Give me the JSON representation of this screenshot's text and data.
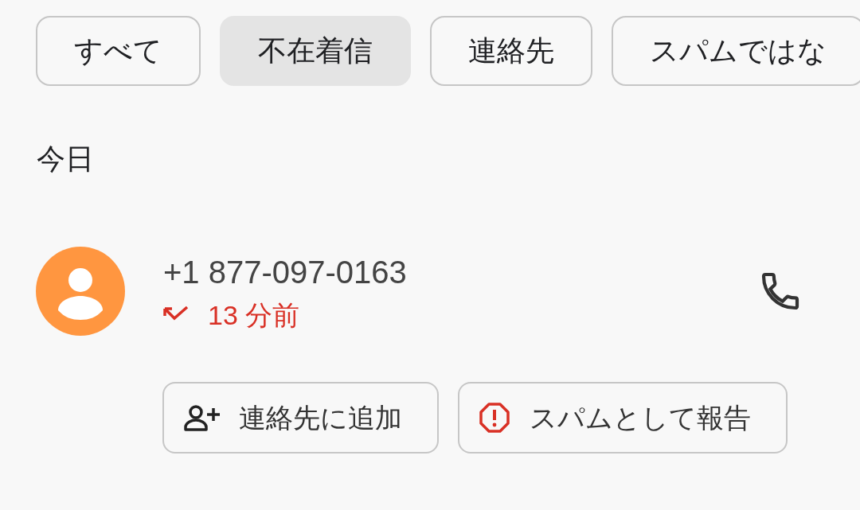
{
  "filter_chips": [
    {
      "label": "すべて",
      "selected": false
    },
    {
      "label": "不在着信",
      "selected": true
    },
    {
      "label": "連絡先",
      "selected": false
    },
    {
      "label": "スパムではな",
      "selected": false
    }
  ],
  "section_header": "今日",
  "calls": [
    {
      "number": "+1 877-097-0163",
      "time": "13 分前",
      "missed": true,
      "actions": [
        {
          "kind": "add_contact",
          "label": "連絡先に追加"
        },
        {
          "kind": "report_spam",
          "label": "スパムとして報告"
        }
      ]
    }
  ]
}
